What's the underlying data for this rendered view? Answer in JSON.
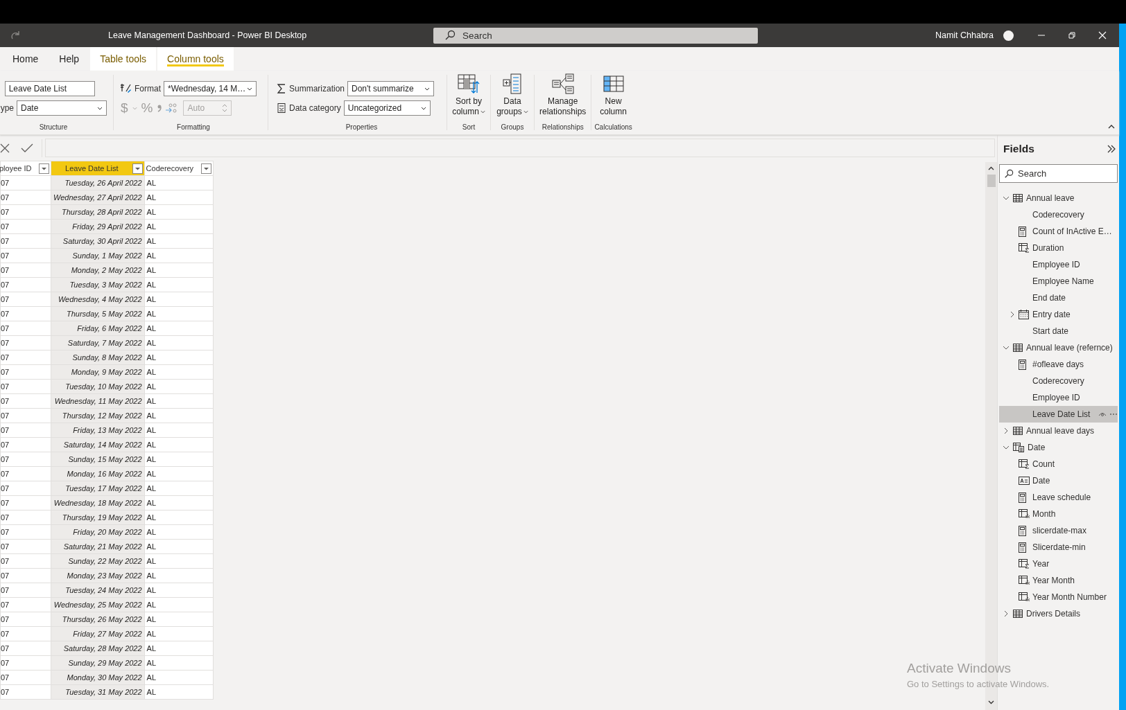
{
  "window": {
    "title": "Leave Management Dashboard - Power BI Desktop",
    "search_placeholder": "Search",
    "user": "Namit Chhabra"
  },
  "ribbon_tabs": [
    {
      "label": "Home",
      "selected": false,
      "contextual": false
    },
    {
      "label": "Help",
      "selected": false,
      "contextual": false
    },
    {
      "label": "Table tools",
      "selected": false,
      "contextual": true
    },
    {
      "label": "Column tools",
      "selected": true,
      "contextual": true
    }
  ],
  "ribbon": {
    "structure": {
      "name_value": "Leave Date List",
      "type_label": "ype",
      "type_value": "Date",
      "group_label": "Structure"
    },
    "formatting": {
      "format_label": "Format",
      "format_value": "*Wednesday, 14 M…",
      "currency": "$",
      "percent": "%",
      "decimal_value": "Auto",
      "disabled": true,
      "group_label": "Formatting"
    },
    "properties": {
      "summarization_label": "Summarization",
      "summarization_value": "Don't summarize",
      "category_label": "Data category",
      "category_value": "Uncategorized",
      "group_label": "Properties"
    },
    "big_groups": [
      {
        "kind": "sort",
        "lines": [
          "Sort by",
          "column"
        ],
        "dropdown": true,
        "group_label": "Sort"
      },
      {
        "kind": "groups",
        "lines": [
          "Data",
          "groups"
        ],
        "dropdown": true,
        "group_label": "Groups"
      },
      {
        "kind": "relationships",
        "lines": [
          "Manage",
          "relationships"
        ],
        "dropdown": false,
        "group_label": "Relationships"
      },
      {
        "kind": "new-column",
        "lines": [
          "New",
          "column"
        ],
        "dropdown": false,
        "group_label": "Calculations"
      }
    ]
  },
  "table": {
    "columns": [
      {
        "label": "ployee ID",
        "selected": false,
        "kind": "text"
      },
      {
        "label": "Leave Date List",
        "selected": true,
        "kind": "date"
      },
      {
        "label": "Coderecovery",
        "selected": false,
        "kind": "text"
      }
    ],
    "rows": [
      [
        "07",
        "Tuesday, 26 April 2022",
        "AL"
      ],
      [
        "07",
        "Wednesday, 27 April 2022",
        "AL"
      ],
      [
        "07",
        "Thursday, 28 April 2022",
        "AL"
      ],
      [
        "07",
        "Friday, 29 April 2022",
        "AL"
      ],
      [
        "07",
        "Saturday, 30 April 2022",
        "AL"
      ],
      [
        "07",
        "Sunday, 1 May 2022",
        "AL"
      ],
      [
        "07",
        "Monday, 2 May 2022",
        "AL"
      ],
      [
        "07",
        "Tuesday, 3 May 2022",
        "AL"
      ],
      [
        "07",
        "Wednesday, 4 May 2022",
        "AL"
      ],
      [
        "07",
        "Thursday, 5 May 2022",
        "AL"
      ],
      [
        "07",
        "Friday, 6 May 2022",
        "AL"
      ],
      [
        "07",
        "Saturday, 7 May 2022",
        "AL"
      ],
      [
        "07",
        "Sunday, 8 May 2022",
        "AL"
      ],
      [
        "07",
        "Monday, 9 May 2022",
        "AL"
      ],
      [
        "07",
        "Tuesday, 10 May 2022",
        "AL"
      ],
      [
        "07",
        "Wednesday, 11 May 2022",
        "AL"
      ],
      [
        "07",
        "Thursday, 12 May 2022",
        "AL"
      ],
      [
        "07",
        "Friday, 13 May 2022",
        "AL"
      ],
      [
        "07",
        "Saturday, 14 May 2022",
        "AL"
      ],
      [
        "07",
        "Sunday, 15 May 2022",
        "AL"
      ],
      [
        "07",
        "Monday, 16 May 2022",
        "AL"
      ],
      [
        "07",
        "Tuesday, 17 May 2022",
        "AL"
      ],
      [
        "07",
        "Wednesday, 18 May 2022",
        "AL"
      ],
      [
        "07",
        "Thursday, 19 May 2022",
        "AL"
      ],
      [
        "07",
        "Friday, 20 May 2022",
        "AL"
      ],
      [
        "07",
        "Saturday, 21 May 2022",
        "AL"
      ],
      [
        "07",
        "Sunday, 22 May 2022",
        "AL"
      ],
      [
        "07",
        "Monday, 23 May 2022",
        "AL"
      ],
      [
        "07",
        "Tuesday, 24 May 2022",
        "AL"
      ],
      [
        "07",
        "Wednesday, 25 May 2022",
        "AL"
      ],
      [
        "07",
        "Thursday, 26 May 2022",
        "AL"
      ],
      [
        "07",
        "Friday, 27 May 2022",
        "AL"
      ],
      [
        "07",
        "Saturday, 28 May 2022",
        "AL"
      ],
      [
        "07",
        "Sunday, 29 May 2022",
        "AL"
      ],
      [
        "07",
        "Monday, 30 May 2022",
        "AL"
      ],
      [
        "07",
        "Tuesday, 31 May 2022",
        "AL"
      ]
    ]
  },
  "fields": {
    "title": "Fields",
    "search_placeholder": "Search",
    "tables": [
      {
        "name": "Annual leave",
        "kind": "table",
        "expanded": true,
        "children": [
          {
            "name": "Coderecovery",
            "kind": "column",
            "selected": false
          },
          {
            "name": "Count of InActive E…",
            "kind": "measure",
            "selected": false
          },
          {
            "name": "Duration",
            "kind": "sum",
            "selected": false
          },
          {
            "name": "Employee ID",
            "kind": "column",
            "selected": false
          },
          {
            "name": "Employee Name",
            "kind": "column",
            "selected": false
          },
          {
            "name": "End date",
            "kind": "column",
            "selected": false
          },
          {
            "name": "Entry date",
            "kind": "hierarchy",
            "selected": false,
            "expanded": false
          },
          {
            "name": "Start date",
            "kind": "column",
            "selected": false
          }
        ]
      },
      {
        "name": "Annual leave (refernce)",
        "kind": "table",
        "expanded": true,
        "children": [
          {
            "name": "#ofleave days",
            "kind": "measure",
            "selected": false
          },
          {
            "name": "Coderecovery",
            "kind": "column",
            "selected": false
          },
          {
            "name": "Employee ID",
            "kind": "column",
            "selected": false
          },
          {
            "name": "Leave Date List",
            "kind": "column",
            "selected": true
          }
        ]
      },
      {
        "name": "Annual leave days",
        "kind": "table",
        "expanded": false
      },
      {
        "name": "Date",
        "kind": "calc-table",
        "expanded": true,
        "children": [
          {
            "name": "Count",
            "kind": "sum",
            "selected": false
          },
          {
            "name": "Date",
            "kind": "text",
            "selected": false
          },
          {
            "name": "Leave schedule",
            "kind": "measure",
            "selected": false
          },
          {
            "name": "Month",
            "kind": "calculated",
            "selected": false
          },
          {
            "name": "slicerdate-max",
            "kind": "measure",
            "selected": false
          },
          {
            "name": "Slicerdate-min",
            "kind": "measure",
            "selected": false
          },
          {
            "name": "Year",
            "kind": "sum",
            "selected": false
          },
          {
            "name": "Year Month",
            "kind": "calculated",
            "selected": false
          },
          {
            "name": "Year Month Number",
            "kind": "calculated",
            "selected": false
          }
        ]
      },
      {
        "name": "Drivers Details",
        "kind": "table",
        "expanded": false
      }
    ]
  },
  "os_notice": {
    "title": "Activate Windows",
    "subtitle": "Go to Settings to activate Windows."
  }
}
